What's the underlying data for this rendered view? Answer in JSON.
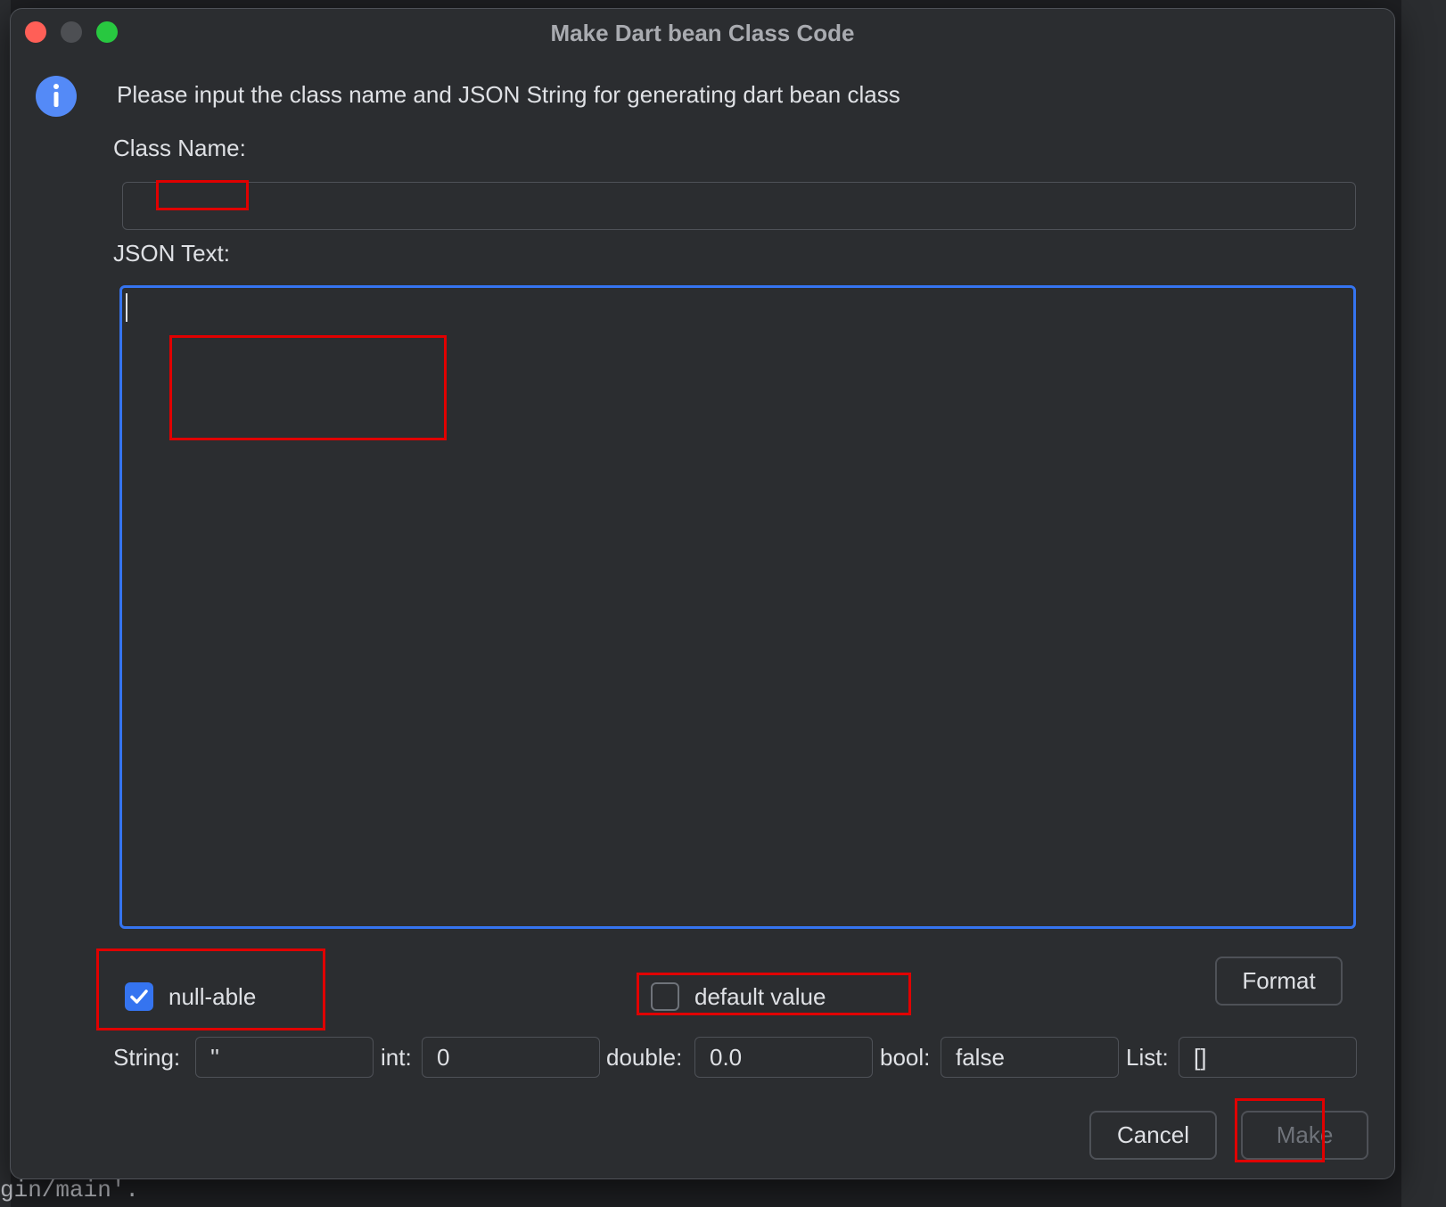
{
  "dialog": {
    "title": "Make Dart bean Class Code",
    "message": "Please input the class name and JSON String for generating dart bean class"
  },
  "class_name": {
    "label": "Class Name:",
    "value": ""
  },
  "json_text": {
    "label": "JSON Text:",
    "value": ""
  },
  "options": {
    "nullable_label": "null-able",
    "nullable_checked": true,
    "default_value_label": "default value",
    "default_value_checked": false,
    "format_label": "Format"
  },
  "defaults": {
    "string_label": "String:",
    "string_value": "''",
    "int_label": "int:",
    "int_value": "0",
    "double_label": "double:",
    "double_value": "0.0",
    "bool_label": "bool:",
    "bool_value": "false",
    "list_label": "List:",
    "list_value": "[]"
  },
  "actions": {
    "cancel_label": "Cancel",
    "make_label": "Make"
  },
  "background": {
    "editor_text": "gin/main'."
  },
  "colors": {
    "accent": "#3574f0",
    "highlight_box": "#e00000",
    "close": "#ff5f57",
    "maximize": "#28c840"
  }
}
